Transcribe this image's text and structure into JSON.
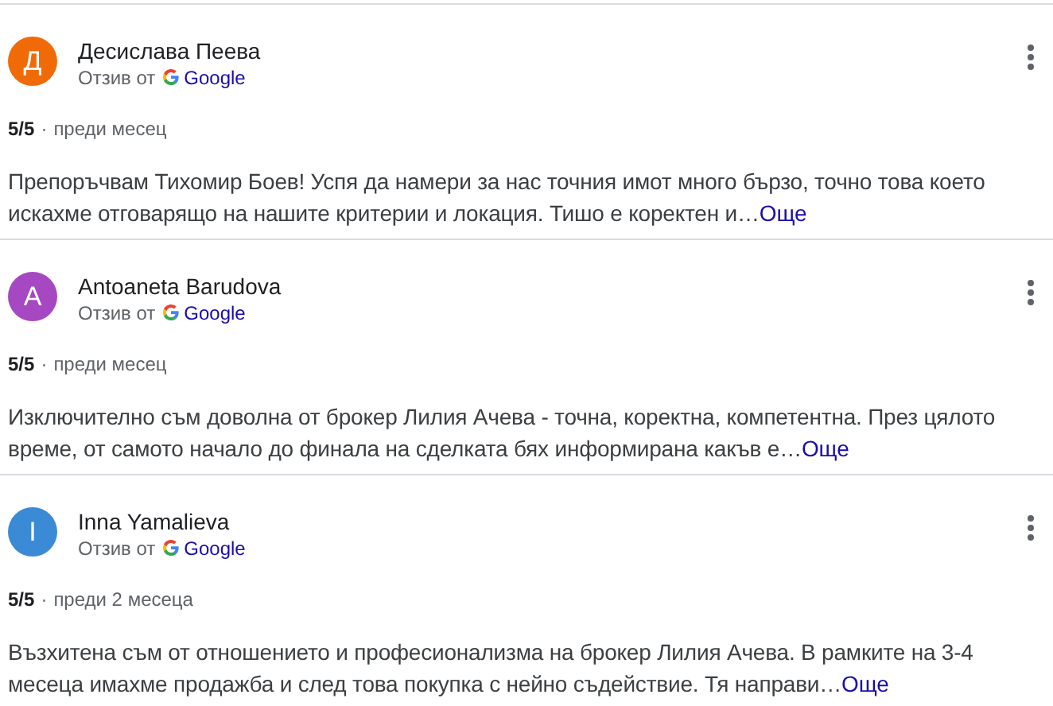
{
  "reviews": [
    {
      "initial": "Д",
      "color": "#f06b08",
      "name": "Десислава Пеева",
      "source_label": "Отзив от",
      "source": "Google",
      "rating": "5/5",
      "separator": "·",
      "time": "преди месец",
      "text": "Препоръчвам Тихомир Боев! Успя да намери за нас точния имот много бързо, точно това което искахме отговарящо на нашите критерии и локация. Тишо е коректен и…",
      "more": "Още"
    },
    {
      "initial": "A",
      "color": "#a548c2",
      "name": "Antoaneta Barudova",
      "source_label": "Отзив от",
      "source": "Google",
      "rating": "5/5",
      "separator": "·",
      "time": "преди месец",
      "text": "Изключително съм доволна от брокер Лилия Ачева - точна, коректна, компетентна. През цялото време, от самото начало до финала на сделката бях информирана какъв е…",
      "more": "Още"
    },
    {
      "initial": "I",
      "color": "#3a8ad6",
      "name": "Inna Yamalieva",
      "source_label": "Отзив от",
      "source": "Google",
      "rating": "5/5",
      "separator": "·",
      "time": "преди 2 месеца",
      "text": "Възхитена съм от отношението и професионализма на брокер Лилия Ачева. В рамките на 3-4 месеца имахме продажба и след това покупка с нейно съдействие. Тя направи…",
      "more": "Още"
    }
  ]
}
